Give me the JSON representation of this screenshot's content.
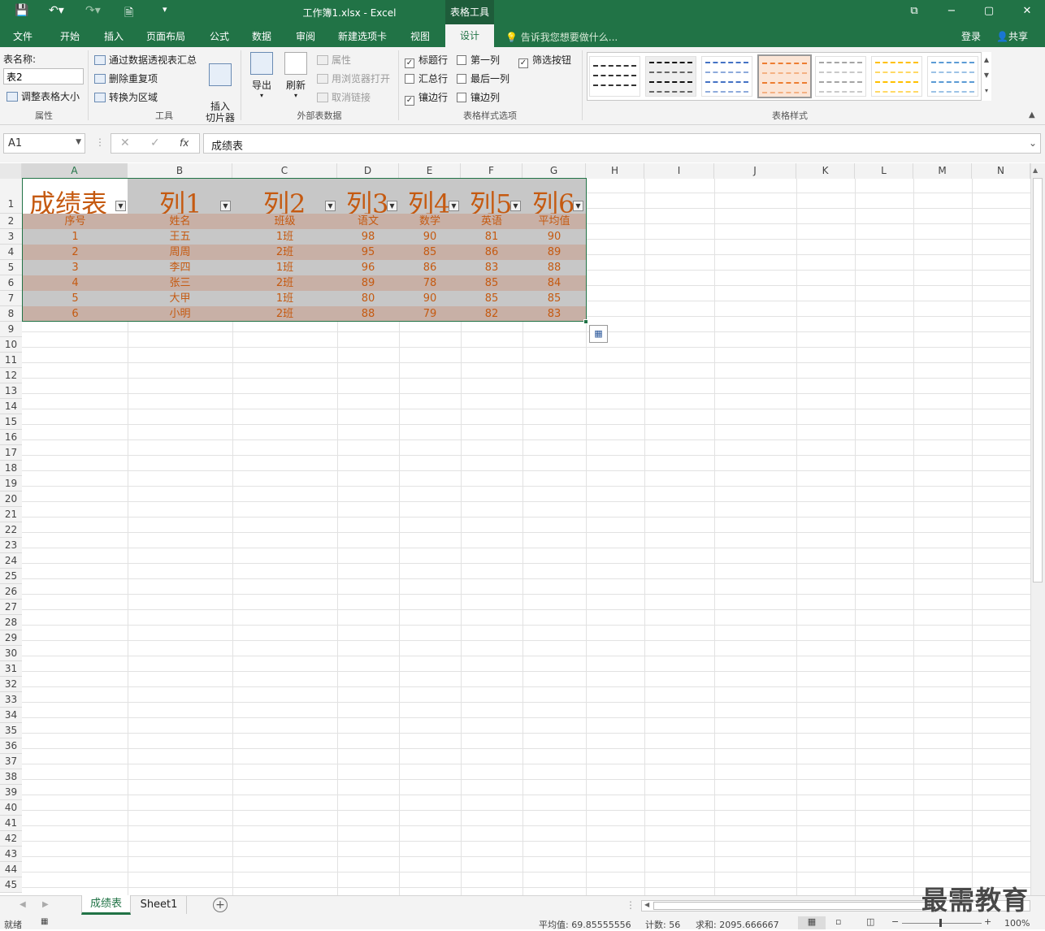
{
  "window": {
    "title": "工作簿1.xlsx - Excel",
    "context_tab": "表格工具",
    "minimize": "−",
    "restore": "▢",
    "close": "✕",
    "ribbon_display": "⧉"
  },
  "tabs": [
    "文件",
    "开始",
    "插入",
    "页面布局",
    "公式",
    "数据",
    "审阅",
    "新建选项卡",
    "视图",
    "设计"
  ],
  "tellme": "告诉我您想要做什么...",
  "account": {
    "login": "登录",
    "share": "共享"
  },
  "ribbon": {
    "properties": {
      "tablename_label": "表名称:",
      "tablename_value": "表2",
      "resize": "调整表格大小",
      "group": "属性"
    },
    "tools": {
      "pivot": "通过数据透视表汇总",
      "remove_dup": "删除重复项",
      "convert": "转换为区域",
      "slicer": "插入\n切片器",
      "group": "工具"
    },
    "external": {
      "export": "导出",
      "refresh": "刷新",
      "props": "属性",
      "browser": "用浏览器打开",
      "unlink": "取消链接",
      "group": "外部表数据"
    },
    "options": {
      "header_row": "标题行",
      "total_row": "汇总行",
      "banded_rows": "镶边行",
      "first_col": "第一列",
      "last_col": "最后一列",
      "banded_cols": "镶边列",
      "filter_btn": "筛选按钮",
      "group": "表格样式选项",
      "checked": {
        "header_row": true,
        "total_row": false,
        "banded_rows": true,
        "first_col": false,
        "last_col": false,
        "banded_cols": false,
        "filter_btn": true
      }
    },
    "styles": {
      "group": "表格样式",
      "swatches": [
        "#333333",
        "#222222",
        "#4472c4",
        "#ed7d31",
        "#a5a5a5",
        "#ffc000",
        "#5b9bd5"
      ]
    }
  },
  "formula": {
    "namebox": "A1",
    "value": "成绩表",
    "fx": "fx",
    "cancel": "✕",
    "confirm": "✓"
  },
  "columns": [
    "A",
    "B",
    "C",
    "D",
    "E",
    "F",
    "G",
    "H",
    "I",
    "J",
    "K",
    "L",
    "M",
    "N"
  ],
  "table": {
    "header": [
      "成绩表",
      "列1",
      "列2",
      "列3",
      "列4",
      "列5",
      "列6"
    ],
    "subheader": [
      "序号",
      "姓名",
      "班级",
      "语文",
      "数学",
      "英语",
      "平均值"
    ],
    "rows": [
      [
        "1",
        "王五",
        "1班",
        "98",
        "90",
        "81",
        "90"
      ],
      [
        "2",
        "周周",
        "2班",
        "95",
        "85",
        "86",
        "89"
      ],
      [
        "3",
        "李四",
        "1班",
        "96",
        "86",
        "83",
        "88"
      ],
      [
        "4",
        "张三",
        "2班",
        "89",
        "78",
        "85",
        "84"
      ],
      [
        "5",
        "大甲",
        "1班",
        "80",
        "90",
        "85",
        "85"
      ],
      [
        "6",
        "小明",
        "2班",
        "88",
        "79",
        "82",
        "83"
      ]
    ]
  },
  "sheets": [
    "成绩表",
    "Sheet1"
  ],
  "status": {
    "ready": "就绪",
    "average": "平均值: 69.85555556",
    "count": "计数: 56",
    "sum": "求和: 2095.666667",
    "zoom": "100%"
  },
  "watermark": "最需教育",
  "colors": {
    "accent": "#217346",
    "table_text": "#c55a11",
    "band_dark": "#c8b0a6",
    "band_light": "#c7c7c7"
  }
}
